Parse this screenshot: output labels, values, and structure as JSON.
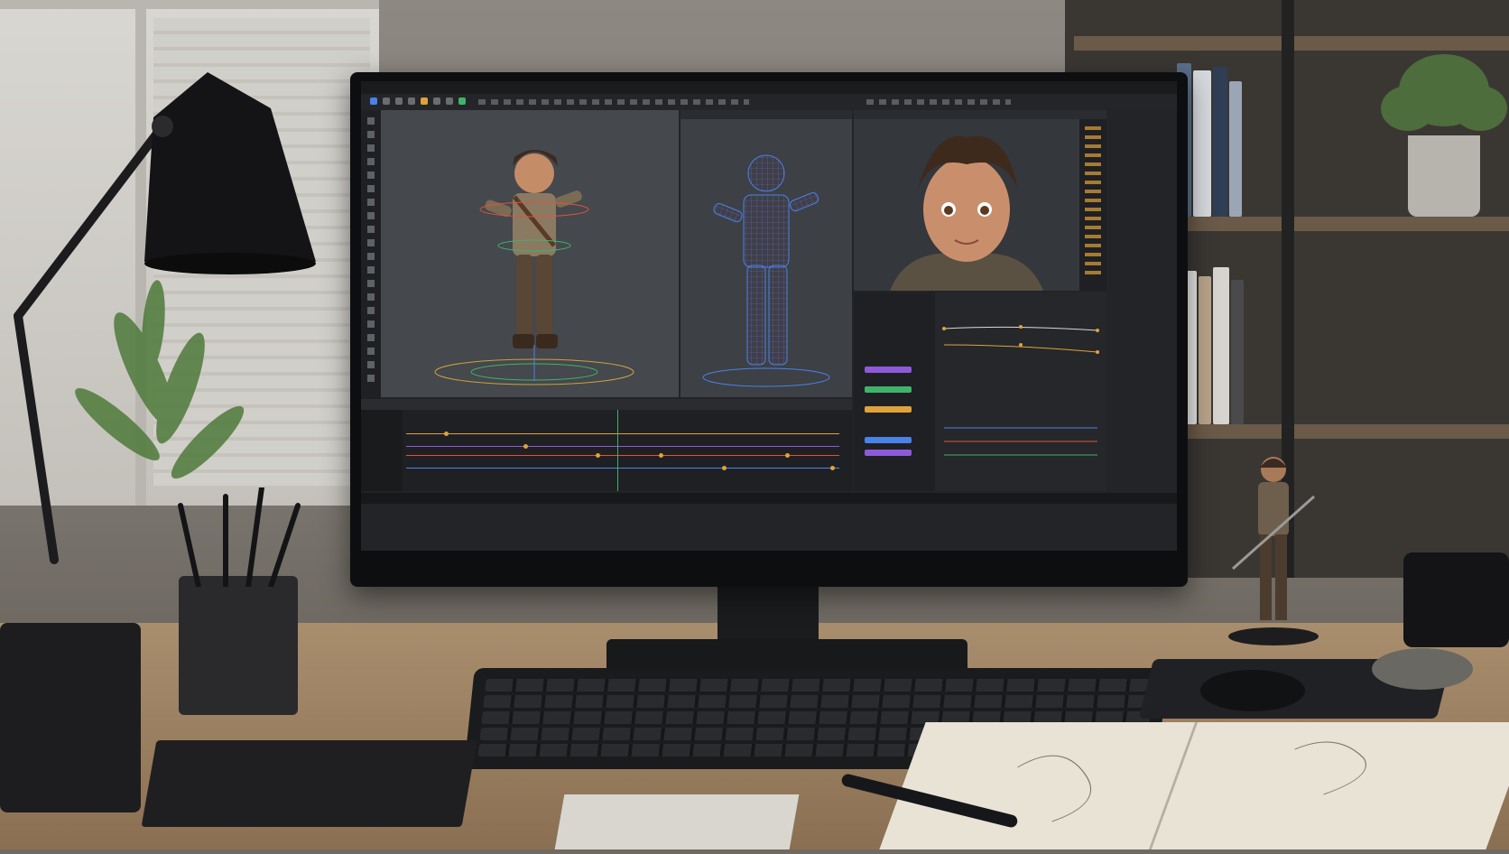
{
  "scene": {
    "description_colors": {
      "wall": "#7b766f",
      "desk": "#a98e6e",
      "monitor_bezel": "#0d0e10",
      "accent_orange": "#e0a23a",
      "accent_purple": "#8d5ad9",
      "accent_blue": "#4a82e8",
      "accent_green": "#3fb36b",
      "accent_red": "#e0533d"
    }
  },
  "app": {
    "icons": [
      "rotate-icon",
      "move-icon",
      "scale-icon",
      "select-icon",
      "camera-icon",
      "light-icon",
      "bone-icon",
      "play-icon"
    ]
  }
}
